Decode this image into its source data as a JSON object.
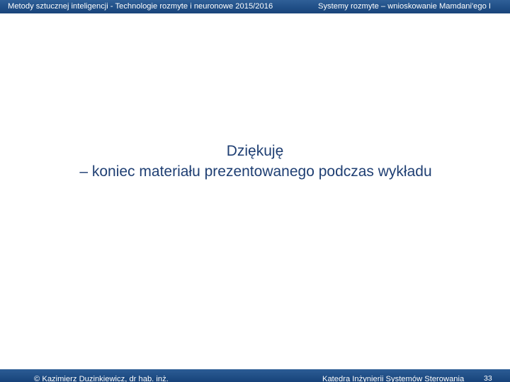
{
  "header": {
    "left_text": "Metody sztucznej inteligencji -  Technologie rozmyte i neuronowe  2015/2016",
    "right_text": "Systemy rozmyte – wnioskowanie Mamdani'ego I"
  },
  "main": {
    "line1": "Dziękuję",
    "line2": "– koniec materiału prezentowanego podczas wykładu"
  },
  "footer": {
    "author": "©  Kazimierz Duzinkiewicz, dr hab. inż.",
    "department": "Katedra Inżynierii Systemów Sterowania",
    "page_number": "33"
  }
}
